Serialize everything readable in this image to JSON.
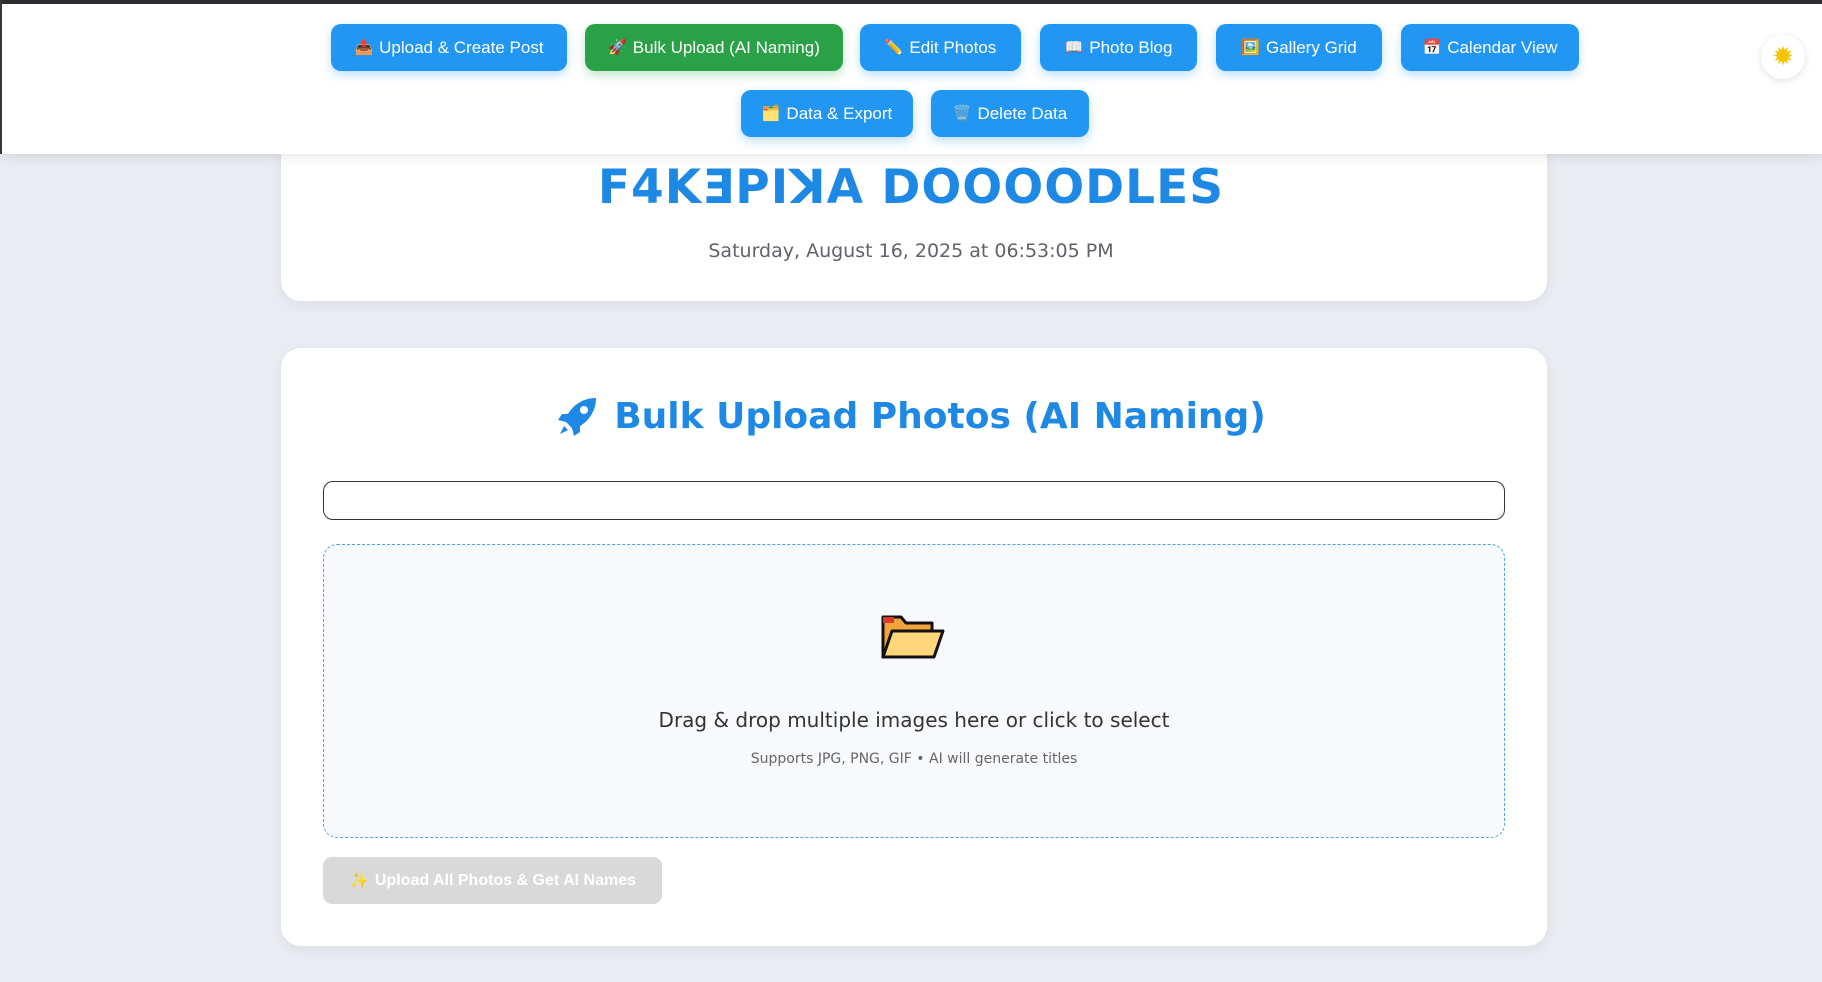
{
  "nav": {
    "buttons": [
      {
        "icon": "📤",
        "label": "Upload & Create Post",
        "active": false
      },
      {
        "icon": "🚀",
        "label": "Bulk Upload (AI Naming)",
        "active": true
      },
      {
        "icon": "✏️",
        "label": "Edit Photos",
        "active": false
      },
      {
        "icon": "📖",
        "label": "Photo Blog",
        "active": false
      },
      {
        "icon": "🖼️",
        "label": "Gallery Grid",
        "active": false
      },
      {
        "icon": "📅",
        "label": "Calendar View",
        "active": false
      },
      {
        "icon": "🗂️",
        "label": "Data & Export",
        "active": false
      },
      {
        "icon": "🗑️",
        "label": "Delete Data",
        "active": false
      }
    ],
    "theme_toggle_icon": "sun-icon",
    "theme_toggle_glyph": "✹"
  },
  "header": {
    "title": "F4KƎPIꓘA DOOOODLES",
    "datetime": "Saturday, August 16, 2025 at 06:53:05 PM"
  },
  "bulk_upload": {
    "title_icon": "🚀",
    "title": "Bulk Upload Photos (AI Naming)",
    "input_value": "",
    "input_placeholder": "",
    "dropzone_text": "Drag & drop multiple images here or click to select",
    "dropzone_subtext": "Supports JPG, PNG, GIF • AI will generate titles",
    "upload_button_icon": "✨",
    "upload_button_label": "Upload All Photos & Get AI Names",
    "upload_button_disabled": true
  },
  "colors": {
    "primary": "#2196f3",
    "active": "#2aa146",
    "title_blue": "#1e88e5",
    "background": "#e9edf2",
    "disabled": "#d9d9d9"
  }
}
